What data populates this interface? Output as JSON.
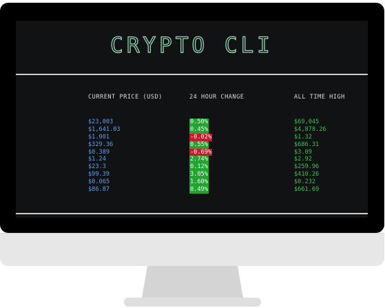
{
  "app": {
    "title": "CRYPTO CLI"
  },
  "headers": {
    "price": "CURRENT PRICE (USD)",
    "change": "24 HOUR CHANGE",
    "ath": "ALL TIME HIGH"
  },
  "rows": [
    {
      "price": "$23,003",
      "change": "0.50%",
      "trend": "up",
      "ath": "$69,045"
    },
    {
      "price": "$1,641.03",
      "change": "0.45%",
      "trend": "up",
      "ath": "$4,878.26"
    },
    {
      "price": "$1.001",
      "change": "-0.02%",
      "trend": "down",
      "ath": "$1.32"
    },
    {
      "price": "$329.36",
      "change": "0.55%",
      "trend": "up",
      "ath": "$686.31"
    },
    {
      "price": "$0.389",
      "change": "-0.69%",
      "trend": "down",
      "ath": "$3.09"
    },
    {
      "price": "$1.24",
      "change": "2.74%",
      "trend": "up",
      "ath": "$2.92"
    },
    {
      "price": "$23.3",
      "change": "0.12%",
      "trend": "up",
      "ath": "$259.96"
    },
    {
      "price": "$99.39",
      "change": "3.05%",
      "trend": "up",
      "ath": "$410.26"
    },
    {
      "price": "$0.065",
      "change": "1.60%",
      "trend": "up",
      "ath": "$0.232"
    },
    {
      "price": "$86.87",
      "change": "0.49%",
      "trend": "up",
      "ath": "$661.69"
    }
  ],
  "colors": {
    "screen_bg": "#111214",
    "title_outline": "#8fd9b0",
    "price_text": "#5f9fe6",
    "ath_text": "#35c44b",
    "positive_bg": "#22a530",
    "negative_bg": "#d0162b",
    "header_text": "#d9d9d9"
  }
}
